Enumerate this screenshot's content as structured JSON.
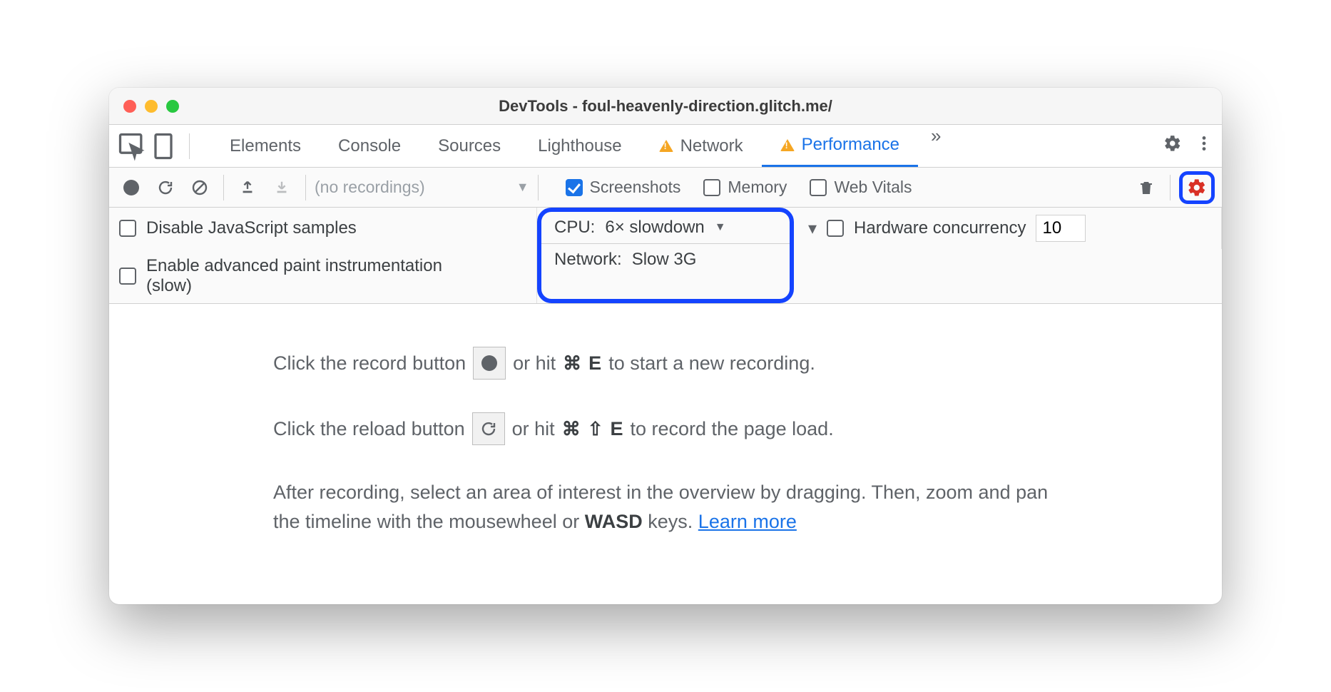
{
  "window": {
    "title": "DevTools - foul-heavenly-direction.glitch.me/"
  },
  "tabs": {
    "items": [
      "Elements",
      "Console",
      "Sources",
      "Lighthouse",
      "Network",
      "Performance"
    ],
    "active": "Performance",
    "network_warning": true,
    "performance_warning": true
  },
  "toolbar": {
    "recordings_placeholder": "(no recordings)",
    "screenshots_label": "Screenshots",
    "screenshots_checked": true,
    "memory_label": "Memory",
    "memory_checked": false,
    "webvitals_label": "Web Vitals",
    "webvitals_checked": false
  },
  "settings": {
    "disable_js_label": "Disable JavaScript samples",
    "disable_js_checked": false,
    "paint_label": "Enable advanced paint instrumentation (slow)",
    "paint_checked": false,
    "cpu_label": "CPU:",
    "cpu_value": "6× slowdown",
    "network_label": "Network:",
    "network_value": "Slow 3G",
    "hw_label": "Hardware concurrency",
    "hw_checked": false,
    "hw_value": "10"
  },
  "hints": {
    "line1a": "Click the record button",
    "line1b": "or hit",
    "line1_key1": "⌘",
    "line1_key2": "E",
    "line1c": "to start a new recording.",
    "line2a": "Click the reload button",
    "line2b": "or hit",
    "line2_key1": "⌘",
    "line2_key2": "⇧",
    "line2_key3": "E",
    "line2c": "to record the page load.",
    "line3a": "After recording, select an area of interest in the overview by dragging. Then, zoom and pan the timeline with the mousewheel or",
    "line3_wasd": "WASD",
    "line3b": "keys.",
    "learn_more": "Learn more"
  }
}
